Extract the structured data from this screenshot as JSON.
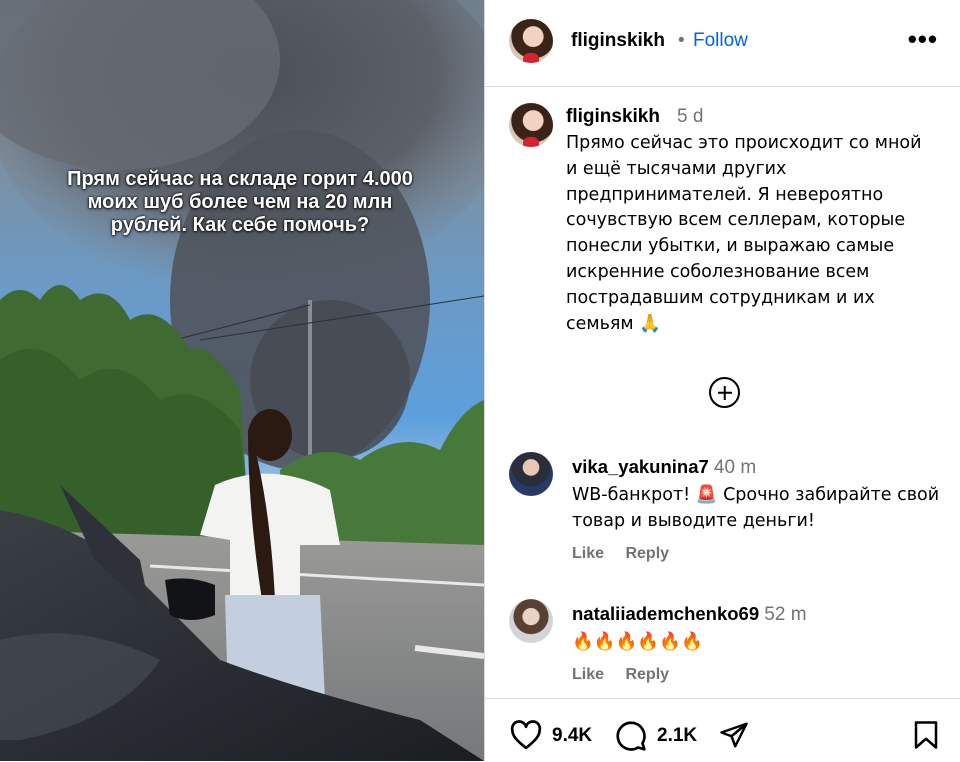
{
  "media": {
    "caption": "Прям сейчас на складе горит 4.000\nмоих шуб более чем на 20 млн\nрублей. Как себе помочь?"
  },
  "header": {
    "username": "fliginskikh",
    "separator": "•",
    "follow_label": "Follow",
    "more_icon": "more-horizontal-icon"
  },
  "post": {
    "username": "fliginskikh",
    "time": "5 d",
    "caption": "Прямо сейчас это происходит со мной и ещё тысячами других предпринимателей. Я невероятно сочувствую всем селлерам, которые понесли убытки, и выражаю самые искренние соболезнование всем пострадавшим сотрудникам и их семьям 🙏"
  },
  "load_more_icon": "plus-circle-icon",
  "comments": [
    {
      "username": "vika_yakunina7",
      "time": "40 m",
      "text": "WB-банкрот! 🚨 Срочно забирайте свой товар и выводите деньги!",
      "like_label": "Like",
      "reply_label": "Reply"
    },
    {
      "username": "nataliiademchenko69",
      "time": "52 m",
      "text": "🔥🔥🔥🔥🔥🔥",
      "like_label": "Like",
      "reply_label": "Reply"
    }
  ],
  "footer": {
    "likes": "9.4K",
    "comments": "2.1K",
    "icons": [
      "heart-icon",
      "comment-icon",
      "share-icon",
      "bookmark-icon"
    ]
  }
}
